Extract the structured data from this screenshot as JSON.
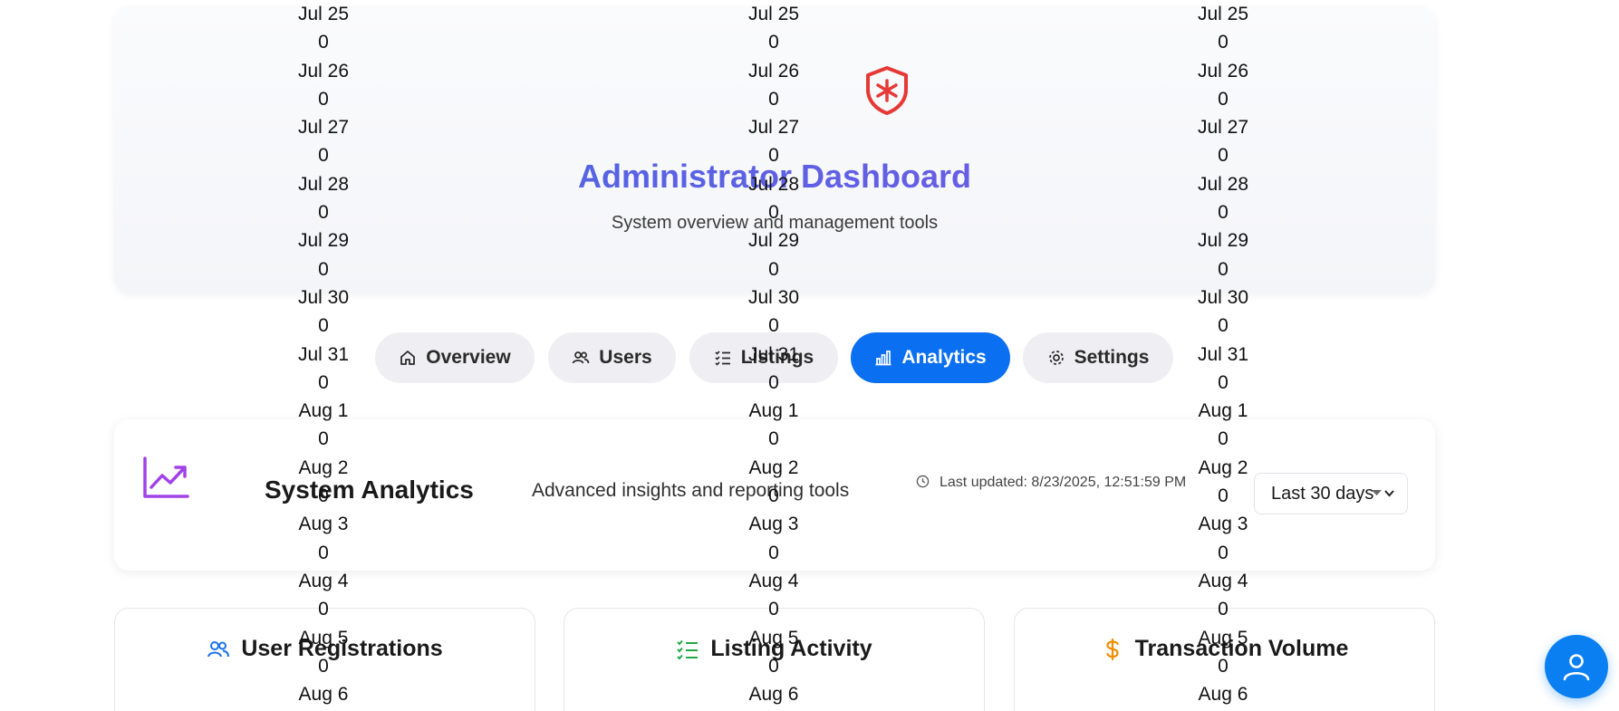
{
  "header": {
    "title": "Administrator Dashboard",
    "subtitle": "System overview and management tools",
    "icon": "shield-star-icon",
    "accent_gradient": [
      "#4169e1",
      "#7b58e6"
    ],
    "icon_color": "#e53935"
  },
  "tabs": [
    {
      "label": "Overview",
      "icon": "home-icon",
      "active": false
    },
    {
      "label": "Users",
      "icon": "users-icon",
      "active": false
    },
    {
      "label": "Listings",
      "icon": "list-check-icon",
      "active": false
    },
    {
      "label": "Analytics",
      "icon": "bar-chart-icon",
      "active": true
    },
    {
      "label": "Settings",
      "icon": "gear-icon",
      "active": false
    }
  ],
  "analytics": {
    "title": "System Analytics",
    "subtitle": "Advanced insights and reporting tools",
    "last_updated": "Last updated: 8/23/2025, 12:51:59 PM",
    "range": {
      "selected": "Last 30 days"
    },
    "icon": "trending-up-icon",
    "icon_color": "#a142e8"
  },
  "stat_cards": [
    {
      "title": "User Registrations",
      "icon": "users-icon",
      "icon_color": "#1a73e8"
    },
    {
      "title": "Listing Activity",
      "icon": "list-check-icon",
      "icon_color": "#22a845"
    },
    {
      "title": "Transaction Volume",
      "icon": "dollar-icon",
      "icon_color": "#f08c00"
    }
  ],
  "chart_labels": [
    {
      "date": "Jul 25",
      "value": "0"
    },
    {
      "date": "Jul 26",
      "value": "0"
    },
    {
      "date": "Jul 27",
      "value": "0"
    },
    {
      "date": "Jul 28",
      "value": "0"
    },
    {
      "date": "Jul 29",
      "value": "0"
    },
    {
      "date": "Jul 30",
      "value": "0"
    },
    {
      "date": "Jul 31",
      "value": "0"
    },
    {
      "date": "Aug 1",
      "value": "0"
    },
    {
      "date": "Aug 2",
      "value": "0"
    },
    {
      "date": "Aug 3",
      "value": "0"
    },
    {
      "date": "Aug 4",
      "value": "0"
    },
    {
      "date": "Aug 5",
      "value": "0"
    },
    {
      "date": "Aug 6",
      "value": ""
    }
  ],
  "fab": {
    "icon": "user-icon",
    "color": "#0a7ff2"
  }
}
